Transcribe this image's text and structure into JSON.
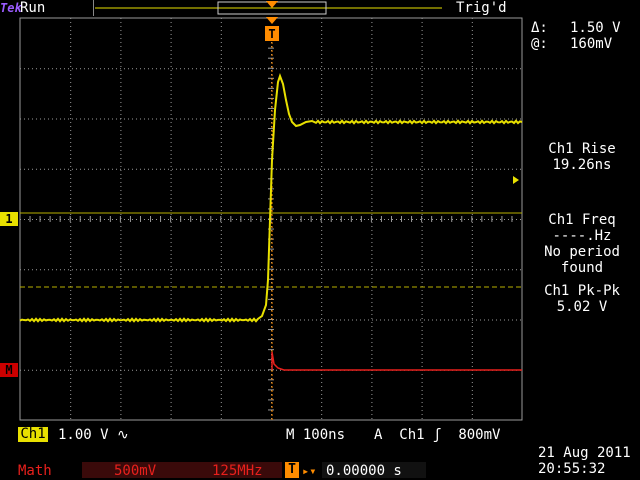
{
  "header": {
    "brand": "Tek",
    "status": "Run",
    "trigger_state": "Trig'd"
  },
  "cursor_readout": {
    "delta_symbol": "Δ:",
    "delta_value": "1.50 V",
    "at_symbol": "@:",
    "at_value": "160mV"
  },
  "measurements": [
    {
      "label": "Ch1 Rise",
      "value": "19.26ns"
    },
    {
      "label": "Ch1 Freq",
      "value": "----.Hz",
      "note": "No period found"
    },
    {
      "label": "Ch1 Pk-Pk",
      "value": "5.02 V"
    }
  ],
  "channel1": {
    "label": "Ch1",
    "scale": "1.00 V",
    "coupling_icon": "ac-wave-icon",
    "marker": "1"
  },
  "timebase": {
    "prefix": "M",
    "value": "100ns"
  },
  "trigger": {
    "mode": "A",
    "source": "Ch1",
    "slope_icon": "rising-edge-icon",
    "level": "800mV",
    "marker": "T"
  },
  "math": {
    "label": "Math",
    "scale": "500mV",
    "bandwidth": "125MHz",
    "marker": "M"
  },
  "trigger_offset": {
    "value": "0.00000 s"
  },
  "datetime": {
    "date": "21 Aug 2011",
    "time": "20:55:32"
  },
  "colors": {
    "ch1": "#e8e000",
    "math": "#e8201c",
    "trigger": "#ff8c00",
    "grid": "#b0b0b0"
  }
}
